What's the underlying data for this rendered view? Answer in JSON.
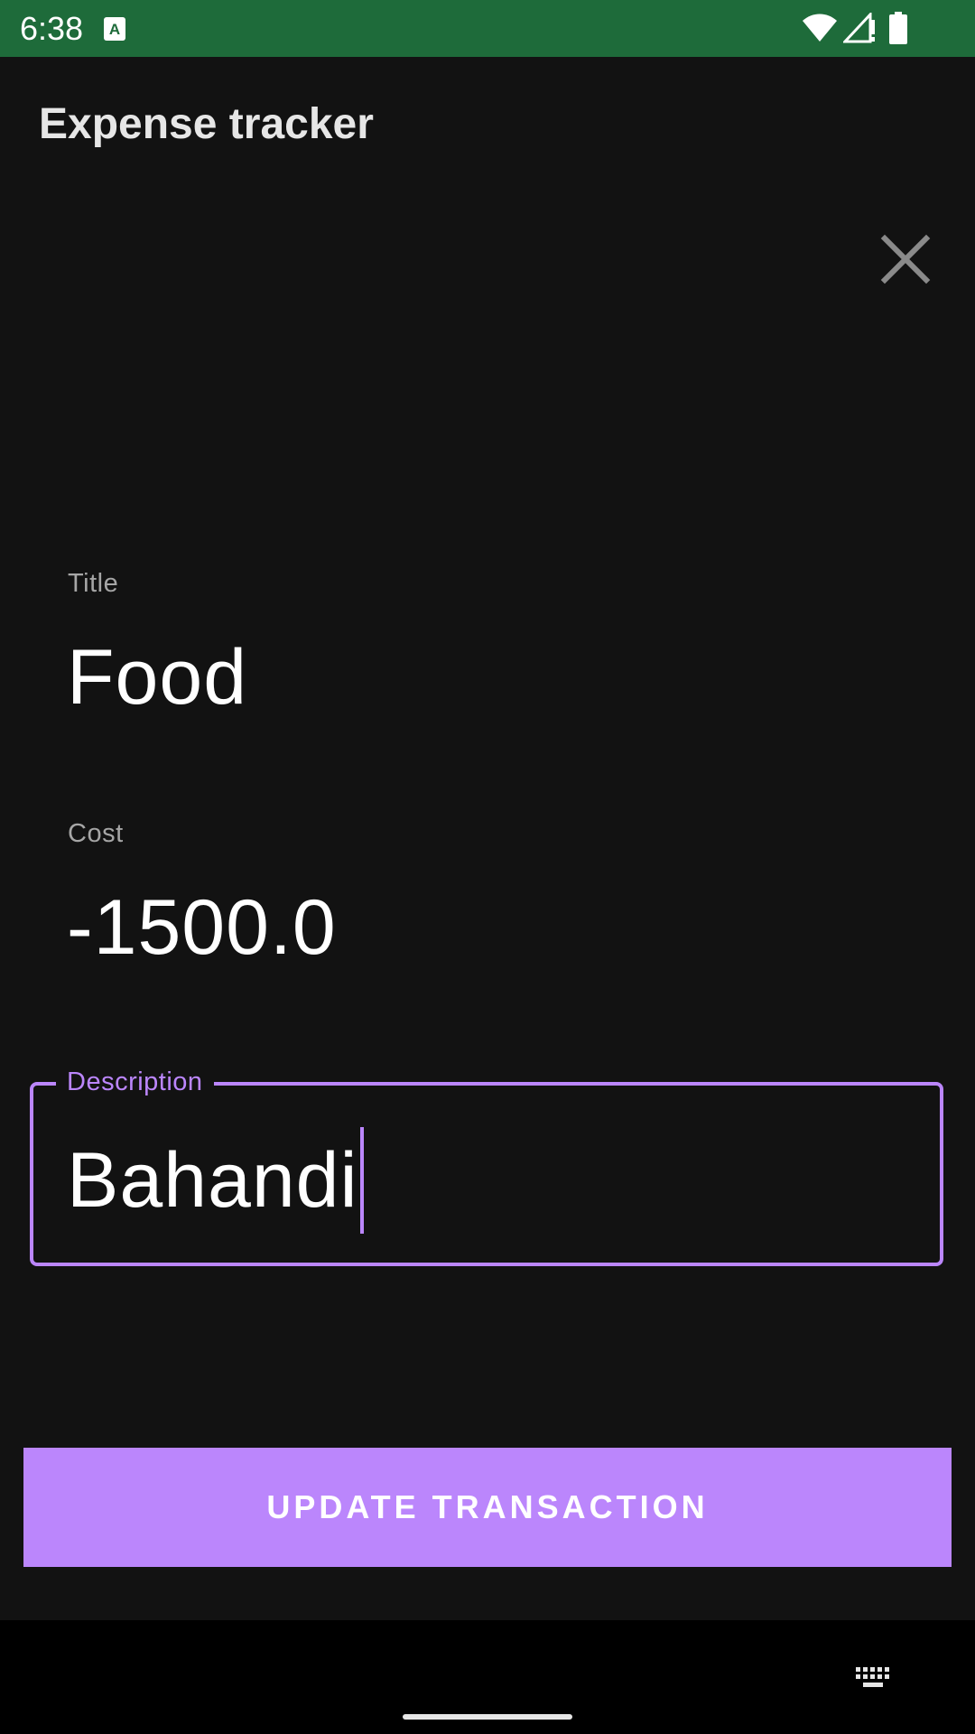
{
  "status_bar": {
    "time": "6:38",
    "background": "#1e6b3a",
    "icons": [
      "keyboard-input-a-icon",
      "wifi-icon",
      "signal-icon",
      "battery-icon"
    ]
  },
  "app_bar": {
    "title": "Expense tracker",
    "close_icon": "close-icon"
  },
  "form": {
    "title": {
      "label": "Title",
      "value": "Food"
    },
    "cost": {
      "label": "Cost",
      "value": "-1500.0"
    },
    "description": {
      "label": "Description",
      "value": "Bahandi",
      "focused": true
    }
  },
  "actions": {
    "update_label": "UPDATE TRANSACTION"
  },
  "nav_bar": {
    "icons": [
      "keyboard-icon",
      "home-handle"
    ]
  },
  "colors": {
    "background": "#121212",
    "accent": "#bb86fc",
    "status_bar": "#1e6b3a",
    "nav_bar": "#000000"
  }
}
